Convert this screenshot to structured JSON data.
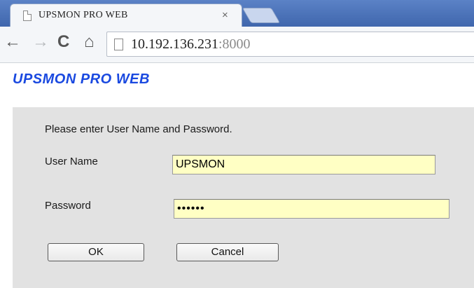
{
  "browser": {
    "tab": {
      "title": "UPSMON PRO WEB",
      "close_glyph": "×"
    },
    "toolbar": {
      "back_glyph": "←",
      "forward_glyph": "→",
      "reload_glyph": "C",
      "home_glyph": "⌂",
      "url_host": "10.192.136.231",
      "url_port": ":8000"
    }
  },
  "page": {
    "title": "UPSMON PRO WEB",
    "prompt": "Please enter User Name and Password.",
    "username": {
      "label": "User Name",
      "value": "UPSMON"
    },
    "password": {
      "label": "Password",
      "value": "••••••"
    },
    "buttons": {
      "ok": "OK",
      "cancel": "Cancel"
    }
  },
  "colors": {
    "title_blue": "#1a49e0",
    "panel_gray": "#e2e2e2",
    "field_yellow": "#ffffc4",
    "tabstrip_blue": "#4a6fb5"
  }
}
